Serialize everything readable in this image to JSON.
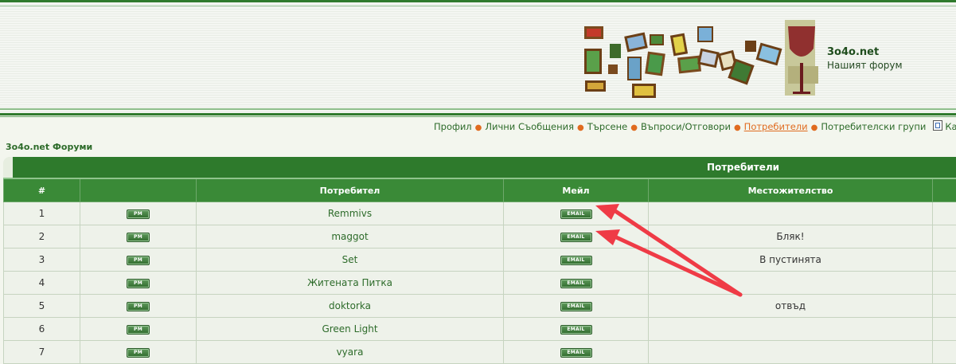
{
  "header": {
    "site_name": "3o4o.net",
    "site_subtitle": "Нашият форум"
  },
  "nav": {
    "items": [
      "Профил",
      "Лични Съобщения",
      "Търсене",
      "Въпроси/Отговори",
      "Потребители",
      "Потребителски групи",
      "Календар"
    ],
    "active": "Потребители"
  },
  "forum_title": "3o4o.net Форуми",
  "table": {
    "title": "Потребители",
    "columns": [
      "#",
      "",
      "Потребител",
      "Мейл",
      "Местожителство"
    ],
    "pm_label": "PM",
    "email_label": "EMAIL",
    "rows": [
      {
        "num": "1",
        "user": "Remmivs",
        "location": ""
      },
      {
        "num": "2",
        "user": "maggot",
        "location": "Бляк!"
      },
      {
        "num": "3",
        "user": "Set",
        "location": "В пустинята"
      },
      {
        "num": "4",
        "user": "Житената Питка",
        "location": ""
      },
      {
        "num": "5",
        "user": "doktorka",
        "location": "отвъд"
      },
      {
        "num": "6",
        "user": "Green Light",
        "location": ""
      },
      {
        "num": "7",
        "user": "vyara",
        "location": ""
      }
    ]
  },
  "colors": {
    "brand_green": "#2e7a2c",
    "link_green": "#2d6b2a",
    "nav_active": "#e06b1f",
    "annotation_red": "#ef3b46"
  }
}
